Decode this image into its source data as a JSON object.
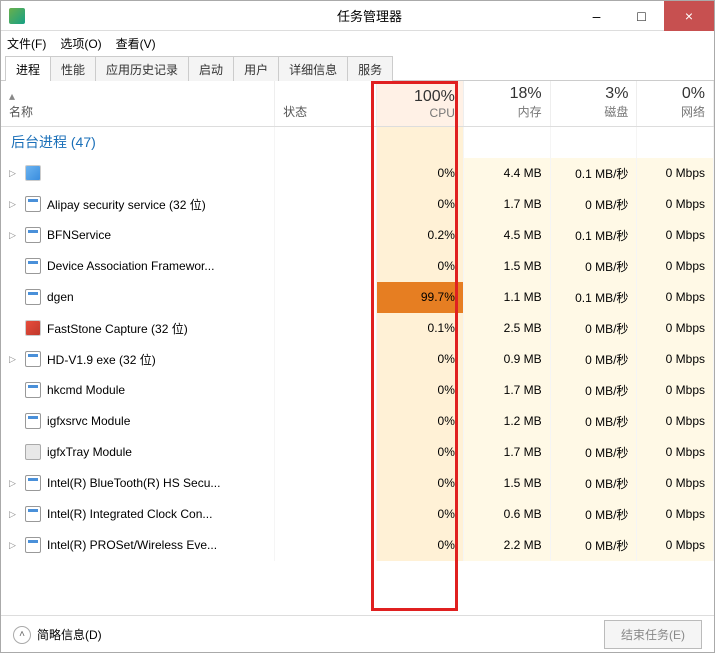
{
  "window": {
    "title": "任务管理器",
    "minimize": "–",
    "maximize": "□",
    "close": "×"
  },
  "menu": {
    "file": "文件(F)",
    "options": "选项(O)",
    "view": "查看(V)"
  },
  "tabs": [
    "进程",
    "性能",
    "应用历史记录",
    "启动",
    "用户",
    "详细信息",
    "服务"
  ],
  "columns": {
    "name": "名称",
    "status": "状态",
    "cpu_pct": "100%",
    "cpu_lbl": "CPU",
    "mem_pct": "18%",
    "mem_lbl": "内存",
    "disk_pct": "3%",
    "disk_lbl": "磁盘",
    "net_pct": "0%",
    "net_lbl": "网络"
  },
  "group": {
    "label": "后台进程 (47)"
  },
  "rows": [
    {
      "icon": "gear",
      "name": "",
      "expand": true,
      "cpu": "0%",
      "mem": "4.4 MB",
      "disk": "0.1 MB/秒",
      "net": "0 Mbps"
    },
    {
      "icon": "app",
      "name": "Alipay security service (32 位)",
      "expand": true,
      "cpu": "0%",
      "mem": "1.7 MB",
      "disk": "0 MB/秒",
      "net": "0 Mbps"
    },
    {
      "icon": "app",
      "name": "BFNService",
      "expand": true,
      "cpu": "0.2%",
      "mem": "4.5 MB",
      "disk": "0.1 MB/秒",
      "net": "0 Mbps"
    },
    {
      "icon": "app",
      "name": "Device Association Framewor...",
      "expand": false,
      "cpu": "0%",
      "mem": "1.5 MB",
      "disk": "0 MB/秒",
      "net": "0 Mbps"
    },
    {
      "icon": "app",
      "name": "dgen",
      "expand": false,
      "cpu": "99.7%",
      "cpu_hot": true,
      "mem": "1.1 MB",
      "disk": "0.1 MB/秒",
      "net": "0 Mbps"
    },
    {
      "icon": "fast",
      "name": "FastStone Capture (32 位)",
      "expand": false,
      "cpu": "0.1%",
      "mem": "2.5 MB",
      "disk": "0 MB/秒",
      "net": "0 Mbps"
    },
    {
      "icon": "app",
      "name": "HD-V1.9 exe (32 位)",
      "expand": true,
      "cpu": "0%",
      "mem": "0.9 MB",
      "disk": "0 MB/秒",
      "net": "0 Mbps"
    },
    {
      "icon": "app",
      "name": "hkcmd Module",
      "expand": false,
      "cpu": "0%",
      "mem": "1.7 MB",
      "disk": "0 MB/秒",
      "net": "0 Mbps"
    },
    {
      "icon": "app",
      "name": "igfxsrvc Module",
      "expand": false,
      "cpu": "0%",
      "mem": "1.2 MB",
      "disk": "0 MB/秒",
      "net": "0 Mbps"
    },
    {
      "icon": "intel",
      "name": "igfxTray Module",
      "expand": false,
      "cpu": "0%",
      "mem": "1.7 MB",
      "disk": "0 MB/秒",
      "net": "0 Mbps"
    },
    {
      "icon": "app",
      "name": "Intel(R) BlueTooth(R) HS Secu...",
      "expand": true,
      "cpu": "0%",
      "mem": "1.5 MB",
      "disk": "0 MB/秒",
      "net": "0 Mbps"
    },
    {
      "icon": "app",
      "name": "Intel(R) Integrated Clock Con...",
      "expand": true,
      "cpu": "0%",
      "mem": "0.6 MB",
      "disk": "0 MB/秒",
      "net": "0 Mbps"
    },
    {
      "icon": "app",
      "name": "Intel(R) PROSet/Wireless Eve...",
      "expand": true,
      "cpu": "0%",
      "mem": "2.2 MB",
      "disk": "0 MB/秒",
      "net": "0 Mbps"
    }
  ],
  "footer": {
    "fewer": "简略信息(D)",
    "end_task": "结束任务(E)"
  }
}
